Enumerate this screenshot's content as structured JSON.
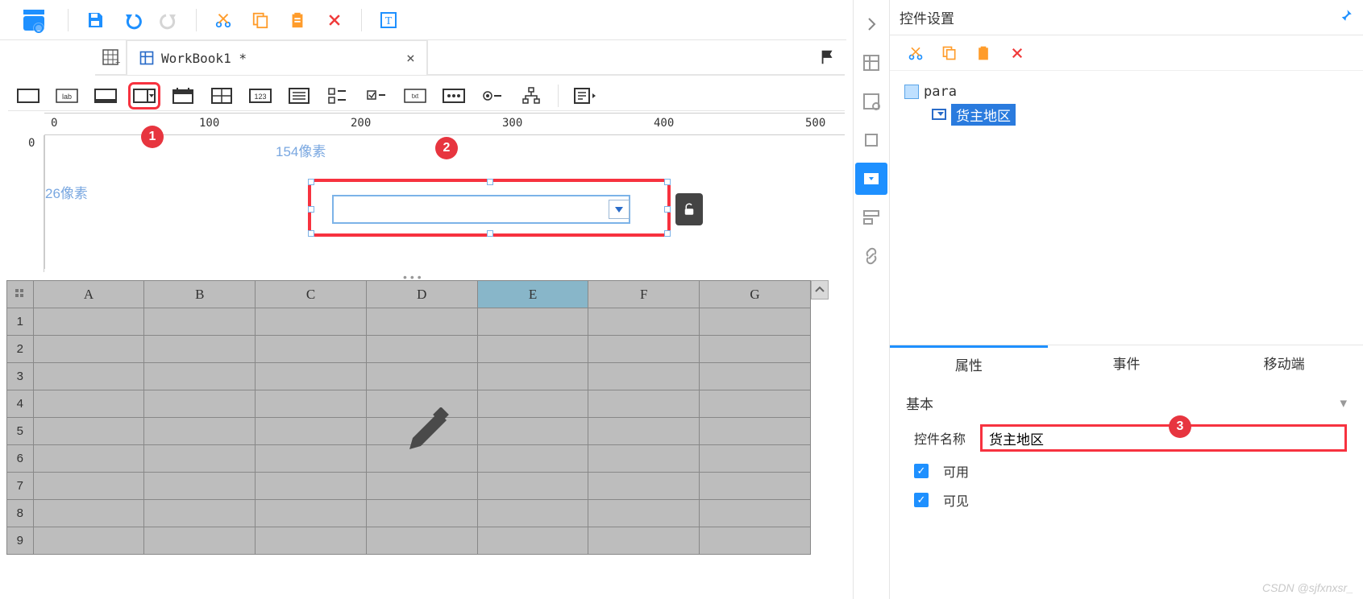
{
  "topToolbar": {
    "iconNames": [
      "save",
      "undo",
      "redo",
      "cut",
      "copy",
      "paste",
      "delete",
      "text-format"
    ]
  },
  "tab": {
    "title": "WorkBook1 *"
  },
  "widgetToolbar": {
    "items": [
      "button",
      "label",
      "text",
      "combo",
      "date",
      "number-group",
      "number",
      "list",
      "checkbox-group",
      "checkbox",
      "textarea",
      "password",
      "radio",
      "tree",
      "more"
    ]
  },
  "rulerH": {
    "ticks": [
      "0",
      "100",
      "200",
      "300",
      "400",
      "500"
    ]
  },
  "rulerV": {
    "ticks": [
      "0"
    ]
  },
  "canvas": {
    "widthLabel": "154像素",
    "heightLabel": "26像素"
  },
  "sheet": {
    "columns": [
      "A",
      "B",
      "C",
      "D",
      "E",
      "F",
      "G"
    ],
    "rows": [
      "1",
      "2",
      "3",
      "4",
      "5",
      "6",
      "7",
      "8",
      "9"
    ],
    "selectedCol": "E"
  },
  "vbar": {
    "items": [
      "table-icon",
      "dataset-icon",
      "crop-icon",
      "combo-icon",
      "layout-icon",
      "link-icon"
    ]
  },
  "rpanel": {
    "title": "控件设置",
    "toolbar": [
      "cut",
      "copy",
      "paste",
      "delete"
    ],
    "tree": {
      "root": "para",
      "child": "货主地区"
    },
    "tabs": {
      "attr": "属性",
      "event": "事件",
      "mobile": "移动端"
    },
    "section": "基本",
    "labels": {
      "widgetName": "控件名称",
      "enabled": "可用",
      "visible": "可见"
    },
    "values": {
      "widgetName": "货主地区",
      "enabled": true,
      "visible": true
    }
  },
  "badges": {
    "one": "1",
    "two": "2",
    "three": "3"
  },
  "watermark": "CSDN @sjfxnxsr_"
}
